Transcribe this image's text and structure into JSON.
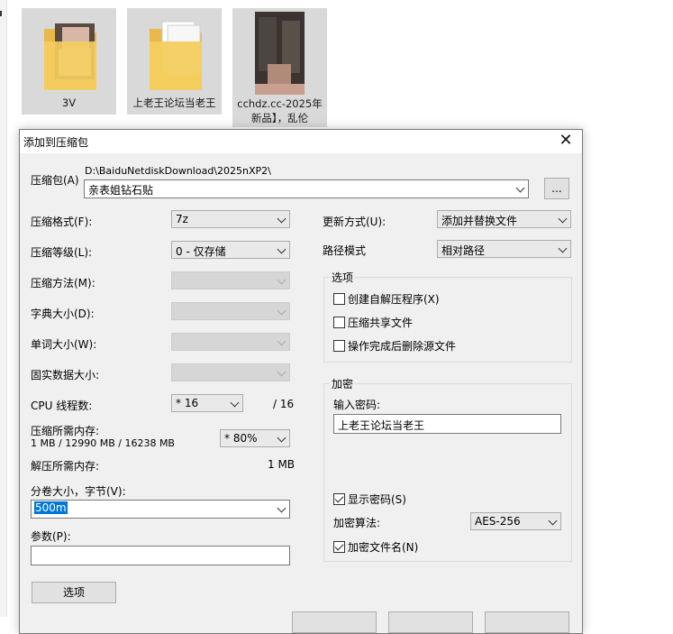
{
  "explorer": {
    "items": [
      {
        "name": "3V"
      },
      {
        "name": "上老王论坛当老王"
      },
      {
        "name": "cchdz.cc-2025年新品】，乱伦"
      }
    ]
  },
  "dialog": {
    "title": "添加到压缩包",
    "archive": {
      "label": "压缩包(A)",
      "path": "D:\\BaiduNetdiskDownload\\2025nXP2\\",
      "name": "亲表姐钻石贴",
      "browse_label": "..."
    },
    "format": {
      "label": "压缩格式(F):",
      "value": "7z"
    },
    "level": {
      "label": "压缩等级(L):",
      "value": "0 - 仅存储"
    },
    "method": {
      "label": "压缩方法(M):"
    },
    "dict": {
      "label": "字典大小(D):"
    },
    "word": {
      "label": "单词大小(W):"
    },
    "solid": {
      "label": "固实数据大小:"
    },
    "cpu": {
      "label": "CPU 线程数:",
      "value": "* 16",
      "max": "/ 16"
    },
    "mem_compress": {
      "label": "压缩所需内存:",
      "detail": "1 MB / 12990 MB / 16238 MB",
      "value": "* 80%"
    },
    "mem_decompress": {
      "label": "解压所需内存:",
      "value": "1 MB"
    },
    "split": {
      "label": "分卷大小，字节(V):",
      "value": "500m"
    },
    "params": {
      "label": "参数(P):",
      "value": ""
    },
    "options_button": "选项",
    "update": {
      "label": "更新方式(U):",
      "value": "添加并替换文件"
    },
    "path_mode": {
      "label": "路径模式",
      "value": "相对路径"
    },
    "options_group": {
      "title": "选项",
      "sfx": "创建自解压程序(X)",
      "shared": "压缩共享文件",
      "delete": "操作完成后删除源文件"
    },
    "encryption": {
      "title": "加密",
      "password_label": "输入密码:",
      "password": "上老王论坛当老王",
      "show_password": "显示密码(S)",
      "method_label": "加密算法:",
      "method": "AES-256",
      "encrypt_names": "加密文件名(N)"
    }
  }
}
